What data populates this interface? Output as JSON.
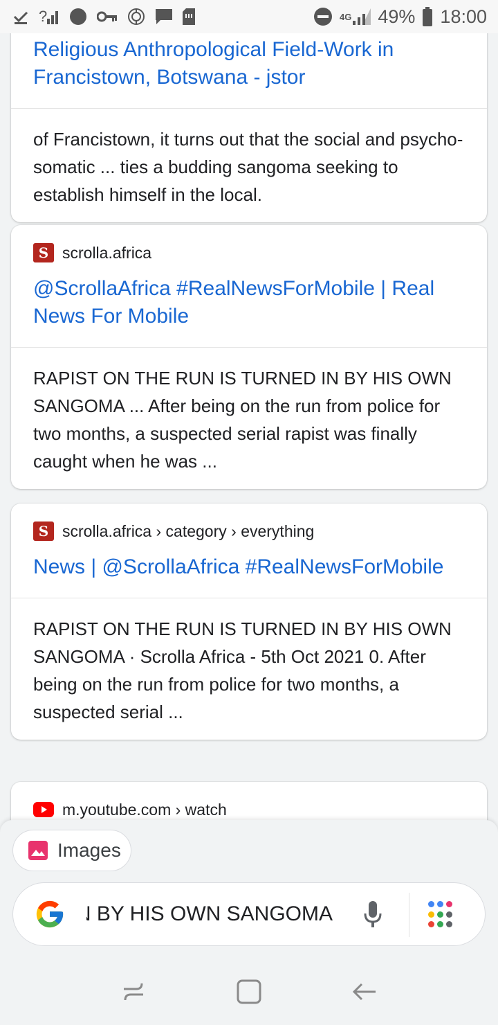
{
  "status_bar": {
    "signal_unknown": "?",
    "network_type": "4G",
    "battery": "49%",
    "time": "18:00"
  },
  "results": [
    {
      "title": "Religious Anthropological Field-Work in Francistown, Botswana - jstor",
      "snippet": "of Francistown, it turns out that the social and psycho-somatic ... ties a budding sangoma seeking to establish himself in the local."
    },
    {
      "source": "scrolla.africa",
      "favicon_letter": "S",
      "title": "@ScrollaAfrica #RealNewsForMobile | Real News For Mobile",
      "snippet": "RAPIST ON THE RUN IS TURNED IN BY HIS OWN SANGOMA ... After being on the run from police for two months, a suspected serial rapist was finally caught when he was ..."
    },
    {
      "source": "scrolla.africa › category › everything",
      "favicon_letter": "S",
      "title": "News | @ScrollaAfrica #RealNewsForMobile",
      "snippet": "RAPIST ON THE RUN IS TURNED IN BY HIS OWN SANGOMA · Scrolla Africa - 5th Oct 2021 0. After being on the run from police for two months, a suspected serial ..."
    },
    {
      "source": "m.youtube.com › watch"
    }
  ],
  "bottom": {
    "images_chip_label": "Images",
    "search_query": "RAPIST ON THE RUN IS TURNED IN BY HIS OWN SANGOMA"
  },
  "colors": {
    "link": "#1967d2",
    "scrolla_favicon": "#b3261e",
    "youtube_red": "#ff0000",
    "images_chip_icon": "#e8336d"
  },
  "icons": {
    "status_left": [
      "check-icon",
      "signal-unknown-icon",
      "circle-icon",
      "key-icon",
      "location-icon",
      "message-icon",
      "sim-icon"
    ],
    "status_right": [
      "do-not-disturb-icon",
      "signal-icon",
      "battery-icon"
    ],
    "bottom": [
      "image-icon",
      "google-logo-icon",
      "mic-icon",
      "apps-dots-icon"
    ],
    "nav": [
      "recent-apps-icon",
      "home-icon",
      "back-icon"
    ]
  }
}
